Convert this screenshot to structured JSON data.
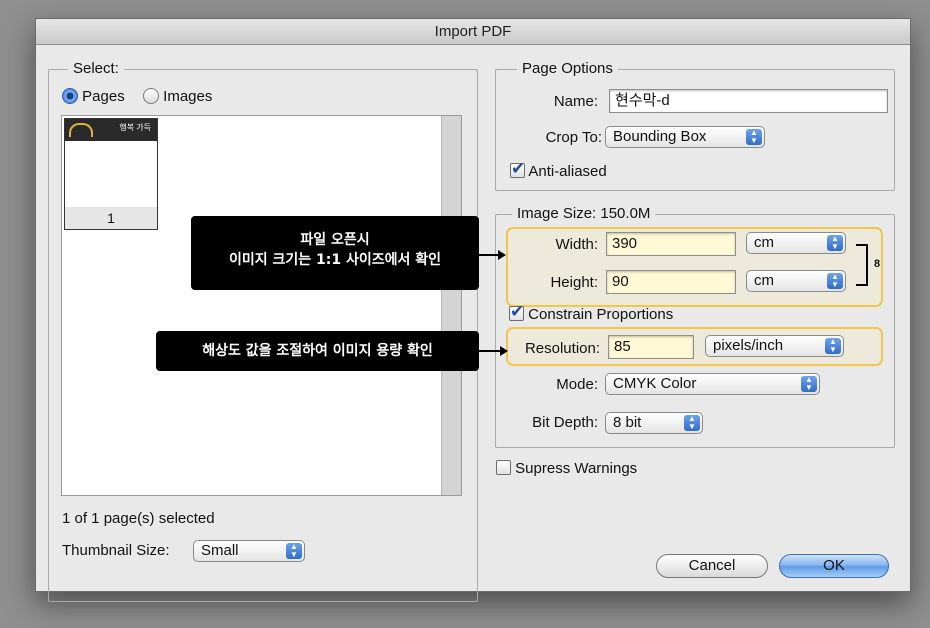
{
  "window": {
    "title": "Import PDF"
  },
  "select_panel": {
    "legend": "Select:",
    "radio_pages": "Pages",
    "radio_images": "Images",
    "thumbnail": {
      "page_number": "1",
      "image_text": "행복 가득"
    },
    "status": "1 of 1 page(s) selected",
    "thumbnail_size_label": "Thumbnail Size:",
    "thumbnail_size_value": "Small"
  },
  "page_options": {
    "legend": "Page Options",
    "name_label": "Name:",
    "name_value": "현수막-d",
    "crop_label": "Crop To:",
    "crop_value": "Bounding Box",
    "anti_aliased": "Anti-aliased"
  },
  "image_size": {
    "legend": "Image Size: 150.0M",
    "width_label": "Width:",
    "width_value": "390",
    "width_unit": "cm",
    "height_label": "Height:",
    "height_value": "90",
    "height_unit": "cm",
    "constrain": "Constrain Proportions",
    "resolution_label": "Resolution:",
    "resolution_value": "85",
    "resolution_unit": "pixels/inch",
    "mode_label": "Mode:",
    "mode_value": "CMYK Color",
    "bitdepth_label": "Bit Depth:",
    "bitdepth_value": "8 bit"
  },
  "suppress_warnings": "Supress Warnings",
  "buttons": {
    "cancel": "Cancel",
    "ok": "OK"
  },
  "annotations": {
    "callout1_line1": "파일 오픈시",
    "callout1_line2": "이미지 크기는 1:1 사이즈에서 확인",
    "callout2": "해상도 값을 조절하여 이미지 용량 확인"
  },
  "colors": {
    "highlight": "#f2c54b",
    "default_button": "#5c9ae6"
  }
}
